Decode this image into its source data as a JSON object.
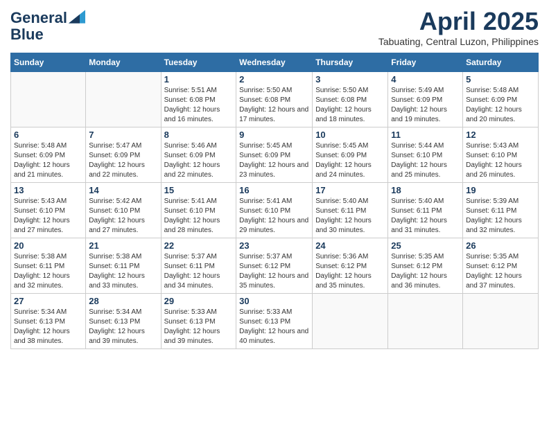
{
  "logo": {
    "line1": "General",
    "line2": "Blue"
  },
  "title": "April 2025",
  "subtitle": "Tabuating, Central Luzon, Philippines",
  "weekdays": [
    "Sunday",
    "Monday",
    "Tuesday",
    "Wednesday",
    "Thursday",
    "Friday",
    "Saturday"
  ],
  "weeks": [
    [
      {
        "day": "",
        "info": ""
      },
      {
        "day": "",
        "info": ""
      },
      {
        "day": "1",
        "info": "Sunrise: 5:51 AM\nSunset: 6:08 PM\nDaylight: 12 hours and 16 minutes."
      },
      {
        "day": "2",
        "info": "Sunrise: 5:50 AM\nSunset: 6:08 PM\nDaylight: 12 hours and 17 minutes."
      },
      {
        "day": "3",
        "info": "Sunrise: 5:50 AM\nSunset: 6:08 PM\nDaylight: 12 hours and 18 minutes."
      },
      {
        "day": "4",
        "info": "Sunrise: 5:49 AM\nSunset: 6:09 PM\nDaylight: 12 hours and 19 minutes."
      },
      {
        "day": "5",
        "info": "Sunrise: 5:48 AM\nSunset: 6:09 PM\nDaylight: 12 hours and 20 minutes."
      }
    ],
    [
      {
        "day": "6",
        "info": "Sunrise: 5:48 AM\nSunset: 6:09 PM\nDaylight: 12 hours and 21 minutes."
      },
      {
        "day": "7",
        "info": "Sunrise: 5:47 AM\nSunset: 6:09 PM\nDaylight: 12 hours and 22 minutes."
      },
      {
        "day": "8",
        "info": "Sunrise: 5:46 AM\nSunset: 6:09 PM\nDaylight: 12 hours and 22 minutes."
      },
      {
        "day": "9",
        "info": "Sunrise: 5:45 AM\nSunset: 6:09 PM\nDaylight: 12 hours and 23 minutes."
      },
      {
        "day": "10",
        "info": "Sunrise: 5:45 AM\nSunset: 6:09 PM\nDaylight: 12 hours and 24 minutes."
      },
      {
        "day": "11",
        "info": "Sunrise: 5:44 AM\nSunset: 6:10 PM\nDaylight: 12 hours and 25 minutes."
      },
      {
        "day": "12",
        "info": "Sunrise: 5:43 AM\nSunset: 6:10 PM\nDaylight: 12 hours and 26 minutes."
      }
    ],
    [
      {
        "day": "13",
        "info": "Sunrise: 5:43 AM\nSunset: 6:10 PM\nDaylight: 12 hours and 27 minutes."
      },
      {
        "day": "14",
        "info": "Sunrise: 5:42 AM\nSunset: 6:10 PM\nDaylight: 12 hours and 27 minutes."
      },
      {
        "day": "15",
        "info": "Sunrise: 5:41 AM\nSunset: 6:10 PM\nDaylight: 12 hours and 28 minutes."
      },
      {
        "day": "16",
        "info": "Sunrise: 5:41 AM\nSunset: 6:10 PM\nDaylight: 12 hours and 29 minutes."
      },
      {
        "day": "17",
        "info": "Sunrise: 5:40 AM\nSunset: 6:11 PM\nDaylight: 12 hours and 30 minutes."
      },
      {
        "day": "18",
        "info": "Sunrise: 5:40 AM\nSunset: 6:11 PM\nDaylight: 12 hours and 31 minutes."
      },
      {
        "day": "19",
        "info": "Sunrise: 5:39 AM\nSunset: 6:11 PM\nDaylight: 12 hours and 32 minutes."
      }
    ],
    [
      {
        "day": "20",
        "info": "Sunrise: 5:38 AM\nSunset: 6:11 PM\nDaylight: 12 hours and 32 minutes."
      },
      {
        "day": "21",
        "info": "Sunrise: 5:38 AM\nSunset: 6:11 PM\nDaylight: 12 hours and 33 minutes."
      },
      {
        "day": "22",
        "info": "Sunrise: 5:37 AM\nSunset: 6:11 PM\nDaylight: 12 hours and 34 minutes."
      },
      {
        "day": "23",
        "info": "Sunrise: 5:37 AM\nSunset: 6:12 PM\nDaylight: 12 hours and 35 minutes."
      },
      {
        "day": "24",
        "info": "Sunrise: 5:36 AM\nSunset: 6:12 PM\nDaylight: 12 hours and 35 minutes."
      },
      {
        "day": "25",
        "info": "Sunrise: 5:35 AM\nSunset: 6:12 PM\nDaylight: 12 hours and 36 minutes."
      },
      {
        "day": "26",
        "info": "Sunrise: 5:35 AM\nSunset: 6:12 PM\nDaylight: 12 hours and 37 minutes."
      }
    ],
    [
      {
        "day": "27",
        "info": "Sunrise: 5:34 AM\nSunset: 6:13 PM\nDaylight: 12 hours and 38 minutes."
      },
      {
        "day": "28",
        "info": "Sunrise: 5:34 AM\nSunset: 6:13 PM\nDaylight: 12 hours and 39 minutes."
      },
      {
        "day": "29",
        "info": "Sunrise: 5:33 AM\nSunset: 6:13 PM\nDaylight: 12 hours and 39 minutes."
      },
      {
        "day": "30",
        "info": "Sunrise: 5:33 AM\nSunset: 6:13 PM\nDaylight: 12 hours and 40 minutes."
      },
      {
        "day": "",
        "info": ""
      },
      {
        "day": "",
        "info": ""
      },
      {
        "day": "",
        "info": ""
      }
    ]
  ]
}
